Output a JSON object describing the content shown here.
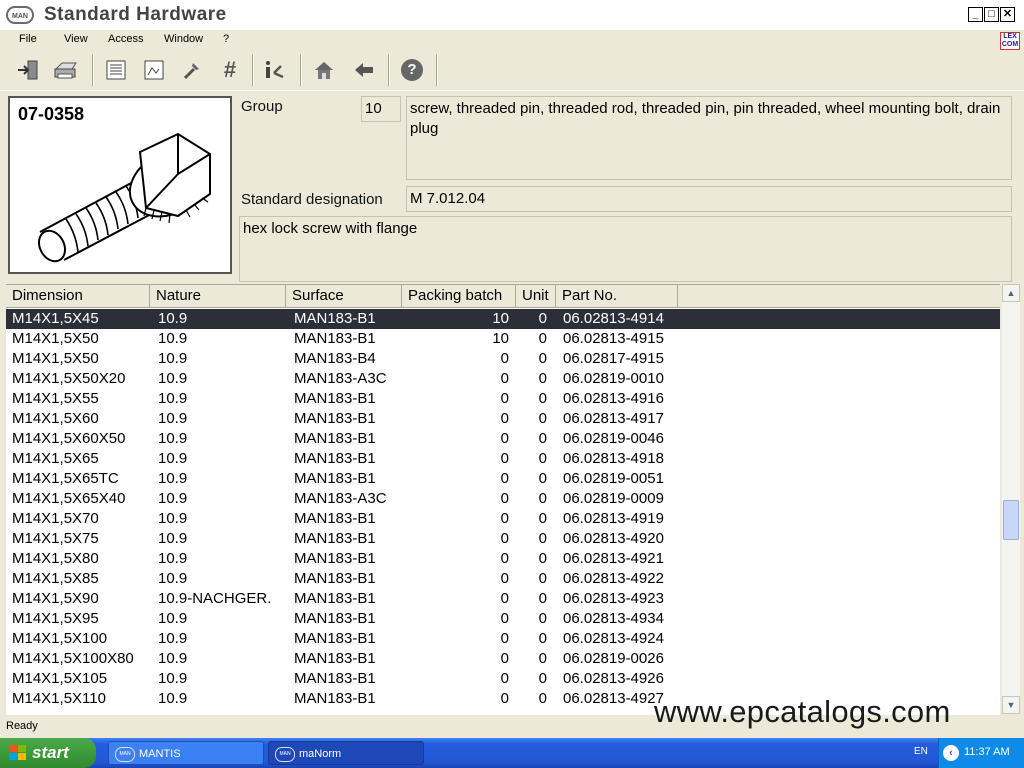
{
  "window": {
    "logo_text": "MAN",
    "title": "Standard Hardware",
    "controls": [
      "_",
      "□",
      "✕"
    ]
  },
  "menu": {
    "items": [
      "File",
      "View",
      "Access",
      "Window",
      "?"
    ],
    "lex_logo": "LEX COM"
  },
  "toolbar": {
    "buttons": [
      "exit-icon",
      "print-icon",
      "list-icon",
      "picture-icon",
      "tool-icon",
      "hash-icon",
      "info-icon",
      "home-icon",
      "back-arrow-icon",
      "help-icon"
    ],
    "hash_glyph": "#",
    "help_glyph": "?"
  },
  "part": {
    "code": "07-0358",
    "group_label": "Group",
    "group_value": "10",
    "group_description": "screw, threaded pin, threaded rod, threaded pin, pin threaded, wheel mounting bolt, drain plug",
    "designation_label": "Standard designation",
    "designation_value": "M 7.012.04",
    "description": "hex lock screw with flange"
  },
  "table": {
    "headers": [
      "Dimension",
      "Nature",
      "Surface",
      "Packing batch",
      "Unit",
      "Part No."
    ],
    "rows": [
      [
        "M14X1,5X45",
        "10.9",
        "MAN183-B1",
        "10",
        "0",
        "06.02813-4914"
      ],
      [
        "M14X1,5X50",
        "10.9",
        "MAN183-B1",
        "10",
        "0",
        "06.02813-4915"
      ],
      [
        "M14X1,5X50",
        "10.9",
        "MAN183-B4",
        "0",
        "0",
        "06.02817-4915"
      ],
      [
        "M14X1,5X50X20",
        "10.9",
        "MAN183-A3C",
        "0",
        "0",
        "06.02819-0010"
      ],
      [
        "M14X1,5X55",
        "10.9",
        "MAN183-B1",
        "0",
        "0",
        "06.02813-4916"
      ],
      [
        "M14X1,5X60",
        "10.9",
        "MAN183-B1",
        "0",
        "0",
        "06.02813-4917"
      ],
      [
        "M14X1,5X60X50",
        "10.9",
        "MAN183-B1",
        "0",
        "0",
        "06.02819-0046"
      ],
      [
        "M14X1,5X65",
        "10.9",
        "MAN183-B1",
        "0",
        "0",
        "06.02813-4918"
      ],
      [
        "M14X1,5X65TC",
        "10.9",
        "MAN183-B1",
        "0",
        "0",
        "06.02819-0051"
      ],
      [
        "M14X1,5X65X40",
        "10.9",
        "MAN183-A3C",
        "0",
        "0",
        "06.02819-0009"
      ],
      [
        "M14X1,5X70",
        "10.9",
        "MAN183-B1",
        "0",
        "0",
        "06.02813-4919"
      ],
      [
        "M14X1,5X75",
        "10.9",
        "MAN183-B1",
        "0",
        "0",
        "06.02813-4920"
      ],
      [
        "M14X1,5X80",
        "10.9",
        "MAN183-B1",
        "0",
        "0",
        "06.02813-4921"
      ],
      [
        "M14X1,5X85",
        "10.9",
        "MAN183-B1",
        "0",
        "0",
        "06.02813-4922"
      ],
      [
        "M14X1,5X90",
        "10.9-NACHGER.",
        "MAN183-B1",
        "0",
        "0",
        "06.02813-4923"
      ],
      [
        "M14X1,5X95",
        "10.9",
        "MAN183-B1",
        "0",
        "0",
        "06.02813-4934"
      ],
      [
        "M14X1,5X100",
        "10.9",
        "MAN183-B1",
        "0",
        "0",
        "06.02813-4924"
      ],
      [
        "M14X1,5X100X80",
        "10.9",
        "MAN183-B1",
        "0",
        "0",
        "06.02819-0026"
      ],
      [
        "M14X1,5X105",
        "10.9",
        "MAN183-B1",
        "0",
        "0",
        "06.02813-4926"
      ],
      [
        "M14X1,5X110",
        "10.9",
        "MAN183-B1",
        "0",
        "0",
        "06.02813-4927"
      ]
    ],
    "selected_row": 0
  },
  "status": {
    "text": "Ready",
    "watermark": "www.epcatalogs.com"
  },
  "taskbar": {
    "start_label": "start",
    "tasks": [
      "MANTIS",
      "maNorm"
    ],
    "language": "EN",
    "clock": "11:37 AM"
  },
  "colors": {
    "window_bg": "#ece9d8",
    "selected_row": "#2c2f38",
    "taskbar_blue": "#245ddb",
    "start_green": "#3c9a3a"
  }
}
